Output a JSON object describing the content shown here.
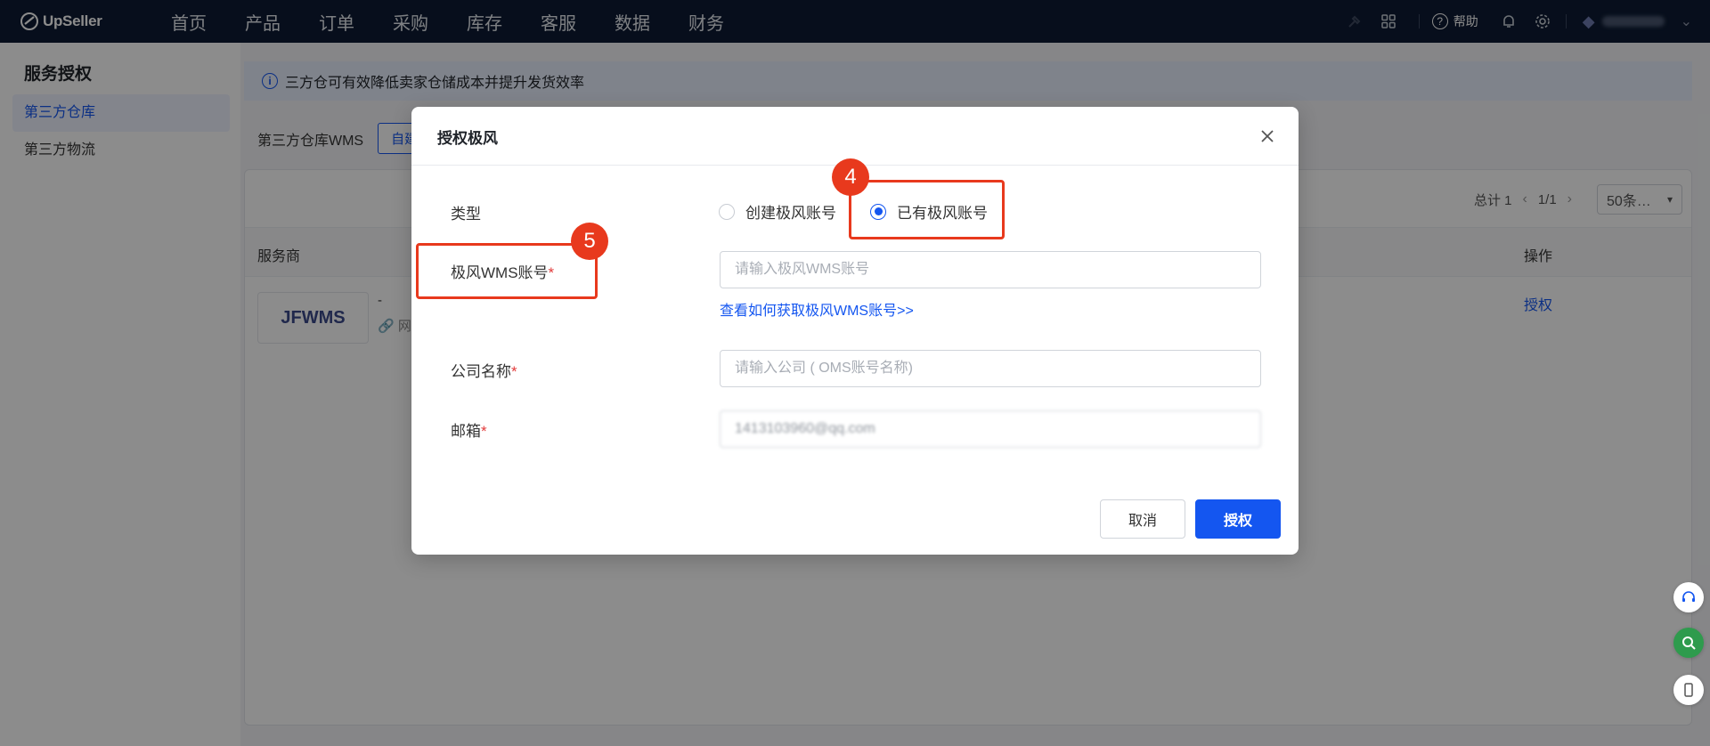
{
  "app": {
    "brand": "UpSeller"
  },
  "nav": {
    "items": [
      "首页",
      "产品",
      "订单",
      "采购",
      "库存",
      "客服",
      "数据",
      "财务"
    ],
    "help": "帮助"
  },
  "sidebar": {
    "title": "服务授权",
    "items": [
      {
        "label": "第三方仓库",
        "active": true
      },
      {
        "label": "第三方物流",
        "active": false
      }
    ]
  },
  "notice": {
    "text": "三方仓可有效降低卖家仓储成本并提升发货效率"
  },
  "filter": {
    "label": "第三方仓库WMS",
    "pill": "自建"
  },
  "table": {
    "total": "总计 1",
    "page": "1/1",
    "page_size": "50条…",
    "headers": {
      "provider": "服务商",
      "ops": "操作"
    },
    "row": {
      "logo_text": "JFWMS",
      "dash": "-",
      "link_text": "网",
      "op": "授权"
    }
  },
  "modal": {
    "title": "授权极风",
    "type_label": "类型",
    "radio_options": [
      {
        "label": "创建极风账号",
        "checked": false
      },
      {
        "label": "已有极风账号",
        "checked": true
      }
    ],
    "account_label": "极风WMS账号",
    "account_placeholder": "请输入极风WMS账号",
    "help_link": "查看如何获取极风WMS账号>>",
    "company_label": "公司名称",
    "company_placeholder": "请输入公司 ( OMS账号名称)",
    "email_label": "邮箱",
    "email_value": "1413103960@qq.com",
    "required_mark": "*",
    "cancel": "取消",
    "submit": "授权"
  },
  "annotations": {
    "badge_4": "4",
    "badge_5": "5"
  },
  "colors": {
    "primary": "#1456f0",
    "nav_bg": "#0d1b33",
    "annotation": "#e8391d",
    "required": "#e23b3b"
  }
}
